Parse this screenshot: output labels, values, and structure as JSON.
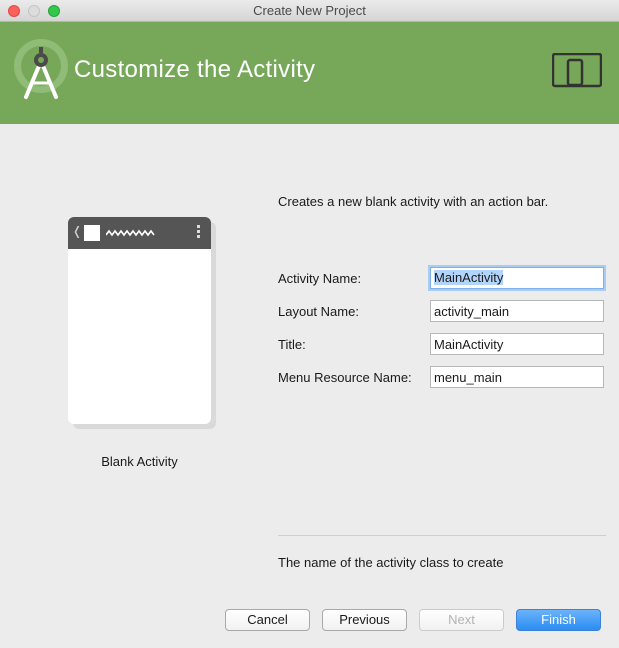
{
  "window": {
    "title": "Create New Project"
  },
  "header": {
    "title": "Customize the Activity",
    "logo_icon": "android-studio-logo-icon",
    "device_icon": "phone-tablet-icon",
    "background_color": "#77a85a"
  },
  "template": {
    "name": "Blank Activity"
  },
  "description": "Creates a new blank activity with an action bar.",
  "fields": [
    {
      "label": "Activity Name:",
      "value": "MainActivity"
    },
    {
      "label": "Layout Name:",
      "value": "activity_main"
    },
    {
      "label": "Title:",
      "value": "MainActivity"
    },
    {
      "label": "Menu Resource Name:",
      "value": "menu_main"
    }
  ],
  "help_text": "The name of the activity class to create",
  "buttons": {
    "cancel": "Cancel",
    "previous": "Previous",
    "next": "Next",
    "finish": "Finish"
  }
}
